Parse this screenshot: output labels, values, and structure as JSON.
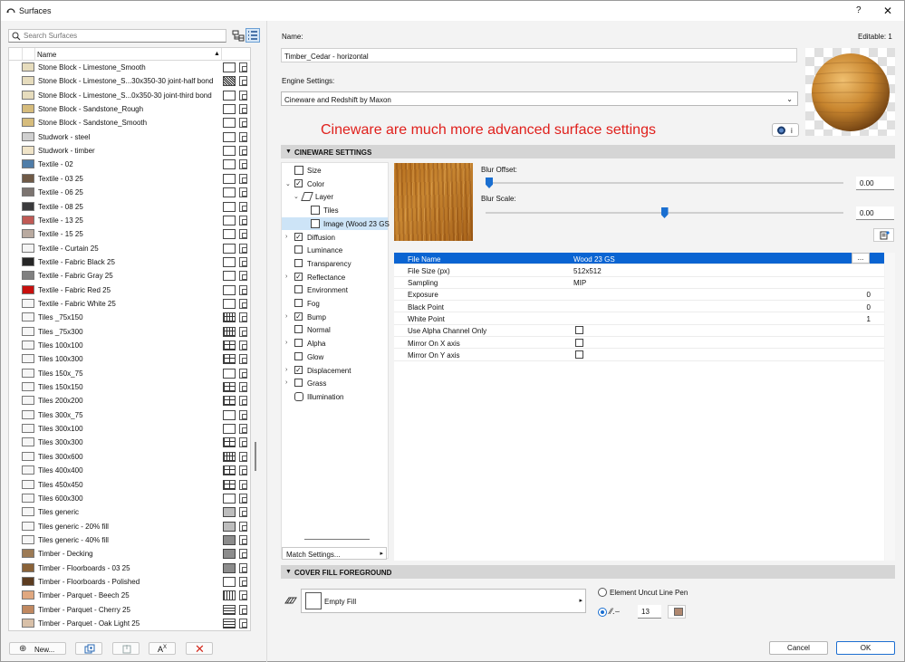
{
  "window": {
    "title": "Surfaces",
    "help": "?",
    "close": "✕"
  },
  "search": {
    "placeholder": "Search Surfaces",
    "value": ""
  },
  "list": {
    "header": "Name",
    "sort_indicator": "▲",
    "items": [
      {
        "name": "Stone Block - Limestone_Smooth",
        "color": "#e6dcbd",
        "fill": "white"
      },
      {
        "name": "Stone Block - Limestone_S...30x350-30 joint-half bond",
        "color": "#e6dcbd",
        "fill": "dots"
      },
      {
        "name": "Stone Block - Limestone_S...0x350-30 joint-third bond",
        "color": "#e6dcbd",
        "fill": "white"
      },
      {
        "name": "Stone Block - Sandstone_Rough",
        "color": "#d6bc7c",
        "fill": "brick"
      },
      {
        "name": "Stone Block - Sandstone_Smooth",
        "color": "#d6bc7c",
        "fill": "brick"
      },
      {
        "name": "Studwork - steel",
        "color": "#d0d0d0",
        "fill": "white"
      },
      {
        "name": "Studwork - timber",
        "color": "#f0e4c8",
        "fill": "white"
      },
      {
        "name": "Textile - 02",
        "color": "#4f7da8",
        "fill": "white"
      },
      {
        "name": "Textile - 03 25",
        "color": "#6f5a46",
        "fill": "white"
      },
      {
        "name": "Textile - 06 25",
        "color": "#7c7470",
        "fill": "white"
      },
      {
        "name": "Textile - 08 25",
        "color": "#3a3a3c",
        "fill": "white"
      },
      {
        "name": "Textile - 13 25",
        "color": "#c05a55",
        "fill": "white"
      },
      {
        "name": "Textile - 15 25",
        "color": "#b9aaa0",
        "fill": "white"
      },
      {
        "name": "Textile - Curtain 25",
        "color": "#f4f4f4",
        "fill": "white"
      },
      {
        "name": "Textile - Fabric Black 25",
        "color": "#262626",
        "fill": "white"
      },
      {
        "name": "Textile - Fabric Gray 25",
        "color": "#808080",
        "fill": "white"
      },
      {
        "name": "Textile - Fabric Red 25",
        "color": "#c8100e",
        "fill": "white"
      },
      {
        "name": "Textile - Fabric White 25",
        "color": "#f6f6f6",
        "fill": "white"
      },
      {
        "name": "Tiles _75x150",
        "color": "#f6f6f6",
        "fill": "grid"
      },
      {
        "name": "Tiles _75x300",
        "color": "#f6f6f6",
        "fill": "grid"
      },
      {
        "name": "Tiles 100x100",
        "color": "#f6f6f6",
        "fill": "tile"
      },
      {
        "name": "Tiles 100x300",
        "color": "#f6f6f6",
        "fill": "tile"
      },
      {
        "name": "Tiles 150x_75",
        "color": "#f6f6f6",
        "fill": "brick"
      },
      {
        "name": "Tiles 150x150",
        "color": "#f6f6f6",
        "fill": "tile"
      },
      {
        "name": "Tiles 200x200",
        "color": "#f6f6f6",
        "fill": "tile"
      },
      {
        "name": "Tiles 300x_75",
        "color": "#f6f6f6",
        "fill": "brick"
      },
      {
        "name": "Tiles 300x100",
        "color": "#f6f6f6",
        "fill": "brick"
      },
      {
        "name": "Tiles 300x300",
        "color": "#f6f6f6",
        "fill": "tile"
      },
      {
        "name": "Tiles 300x600",
        "color": "#f6f6f6",
        "fill": "grid"
      },
      {
        "name": "Tiles 400x400",
        "color": "#f6f6f6",
        "fill": "tile"
      },
      {
        "name": "Tiles 450x450",
        "color": "#f6f6f6",
        "fill": "tile"
      },
      {
        "name": "Tiles 600x300",
        "color": "#f6f6f6",
        "fill": "brick"
      },
      {
        "name": "Tiles generic",
        "color": "#f6f6f6",
        "fill": "gray"
      },
      {
        "name": "Tiles generic - 20% fill",
        "color": "#f6f6f6",
        "fill": "gray"
      },
      {
        "name": "Tiles generic - 40% fill",
        "color": "#f6f6f6",
        "fill": "darkgray"
      },
      {
        "name": "Timber - Decking",
        "color": "#9c7a55",
        "fill": "darkgray"
      },
      {
        "name": "Timber - Floorboards - 03 25",
        "color": "#8a6238",
        "fill": "darkgray"
      },
      {
        "name": "Timber - Floorboards - Polished",
        "color": "#5c3c20",
        "fill": "white"
      },
      {
        "name": "Timber - Parquet - Beech 25",
        "color": "#e0a880",
        "fill": "vlines"
      },
      {
        "name": "Timber - Parquet - Cherry 25",
        "color": "#c08860",
        "fill": "hlines"
      },
      {
        "name": "Timber - Parquet - Oak Light 25",
        "color": "#d8c0a8",
        "fill": "hlines"
      }
    ]
  },
  "bottom_buttons": {
    "new_label": "New..."
  },
  "name_label": "Name:",
  "editable": "Editable: 1",
  "surface_name": "Timber_Cedar - horizontal",
  "engine_label": "Engine Settings:",
  "engine_value": "Cineware and Redshift by Maxon",
  "annotation": "Cineware are much more advanced surface settings",
  "info_icon": "i",
  "cineware_section": "CINEWARE SETTINGS",
  "tree": [
    {
      "label": "Size",
      "indent": 0,
      "exp": "",
      "cb": "none",
      "icon": "size"
    },
    {
      "label": "Color",
      "indent": 0,
      "exp": "v",
      "cb": "checked",
      "icon": ""
    },
    {
      "label": "Layer",
      "indent": 1,
      "exp": "v",
      "cb": "none",
      "icon": "layer"
    },
    {
      "label": "Tiles",
      "indent": 2,
      "exp": "",
      "cb": "none",
      "icon": "tiles"
    },
    {
      "label": "Image (Wood 23 GS",
      "indent": 2,
      "exp": "",
      "cb": "none",
      "icon": "image",
      "selected": true
    },
    {
      "label": "Diffusion",
      "indent": 0,
      "exp": ">",
      "cb": "checked",
      "icon": ""
    },
    {
      "label": "Luminance",
      "indent": 0,
      "exp": "",
      "cb": "empty",
      "icon": ""
    },
    {
      "label": "Transparency",
      "indent": 0,
      "exp": "",
      "cb": "empty",
      "icon": ""
    },
    {
      "label": "Reflectance",
      "indent": 0,
      "exp": ">",
      "cb": "checked",
      "icon": ""
    },
    {
      "label": "Environment",
      "indent": 0,
      "exp": "",
      "cb": "empty",
      "icon": ""
    },
    {
      "label": "Fog",
      "indent": 0,
      "exp": "",
      "cb": "empty",
      "icon": ""
    },
    {
      "label": "Bump",
      "indent": 0,
      "exp": ">",
      "cb": "checked",
      "icon": ""
    },
    {
      "label": "Normal",
      "indent": 0,
      "exp": "",
      "cb": "empty",
      "icon": ""
    },
    {
      "label": "Alpha",
      "indent": 0,
      "exp": ">",
      "cb": "empty",
      "icon": ""
    },
    {
      "label": "Glow",
      "indent": 0,
      "exp": "",
      "cb": "empty",
      "icon": ""
    },
    {
      "label": "Displacement",
      "indent": 0,
      "exp": ">",
      "cb": "checked",
      "icon": ""
    },
    {
      "label": "Grass",
      "indent": 0,
      "exp": ">",
      "cb": "empty",
      "icon": ""
    },
    {
      "label": "Illumination",
      "indent": 0,
      "exp": "",
      "cb": "none",
      "icon": "illum"
    }
  ],
  "match_settings": "Match Settings...",
  "blur_offset_label": "Blur Offset:",
  "blur_offset_value": "0.00",
  "blur_offset_level": 0.0,
  "blur_scale_label": "Blur Scale:",
  "blur_scale_value": "0.00",
  "blur_scale_level": 0.5,
  "properties": [
    {
      "key": "File Name",
      "value": "Wood 23 GS",
      "highlight": true,
      "browse": "..."
    },
    {
      "key": "File Size (px)",
      "value": "512x512"
    },
    {
      "key": "Sampling",
      "value": "MIP"
    },
    {
      "key": "Exposure",
      "value_right": "0"
    },
    {
      "key": "Black Point",
      "value_right": "0"
    },
    {
      "key": "White Point",
      "value_right": "1"
    },
    {
      "key": "Use Alpha Channel Only",
      "checkbox": true
    },
    {
      "key": "Mirror On X axis",
      "checkbox": true
    },
    {
      "key": "Mirror On Y axis",
      "checkbox": true
    }
  ],
  "cover_section": "COVER FILL FOREGROUND",
  "cover_fill": "Empty Fill",
  "element_pen_label": "Element Uncut Line Pen",
  "pen_value": "13",
  "pen_color": "#b08870",
  "cancel": "Cancel",
  "ok": "OK"
}
